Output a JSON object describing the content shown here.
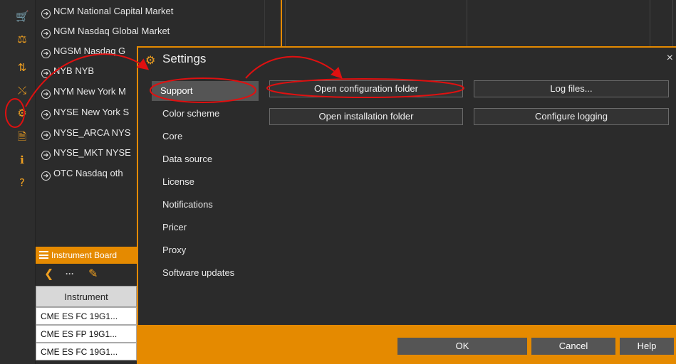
{
  "exchanges": [
    "NCM National Capital Market",
    "NGM Nasdaq Global Market",
    "NGSM Nasdaq G",
    "NYB NYB",
    "NYM New York M",
    "NYSE New York S",
    "NYSE_ARCA NYS",
    "NYSE_MKT NYSE",
    "OTC Nasdaq oth"
  ],
  "instrument_board": {
    "title": "Instrument Board",
    "column": "Instrument",
    "rows": [
      "CME ES FC 19G1...",
      "CME ES FP 19G1...",
      "CME ES FC 19G1..."
    ]
  },
  "settings": {
    "title": "Settings",
    "close": "×",
    "menu": [
      "Support",
      "Color scheme",
      "Core",
      "Data source",
      "License",
      "Notifications",
      "Pricer",
      "Proxy",
      "Software updates"
    ],
    "buttons": {
      "open_config": "Open configuration folder",
      "log_files": "Log files...",
      "open_install": "Open installation folder",
      "configure_logging": "Configure logging"
    },
    "footer": {
      "ok": "OK",
      "cancel": "Cancel",
      "help": "Help"
    }
  },
  "colors": {
    "accent": "#e58a00",
    "annotation": "#e01010"
  }
}
